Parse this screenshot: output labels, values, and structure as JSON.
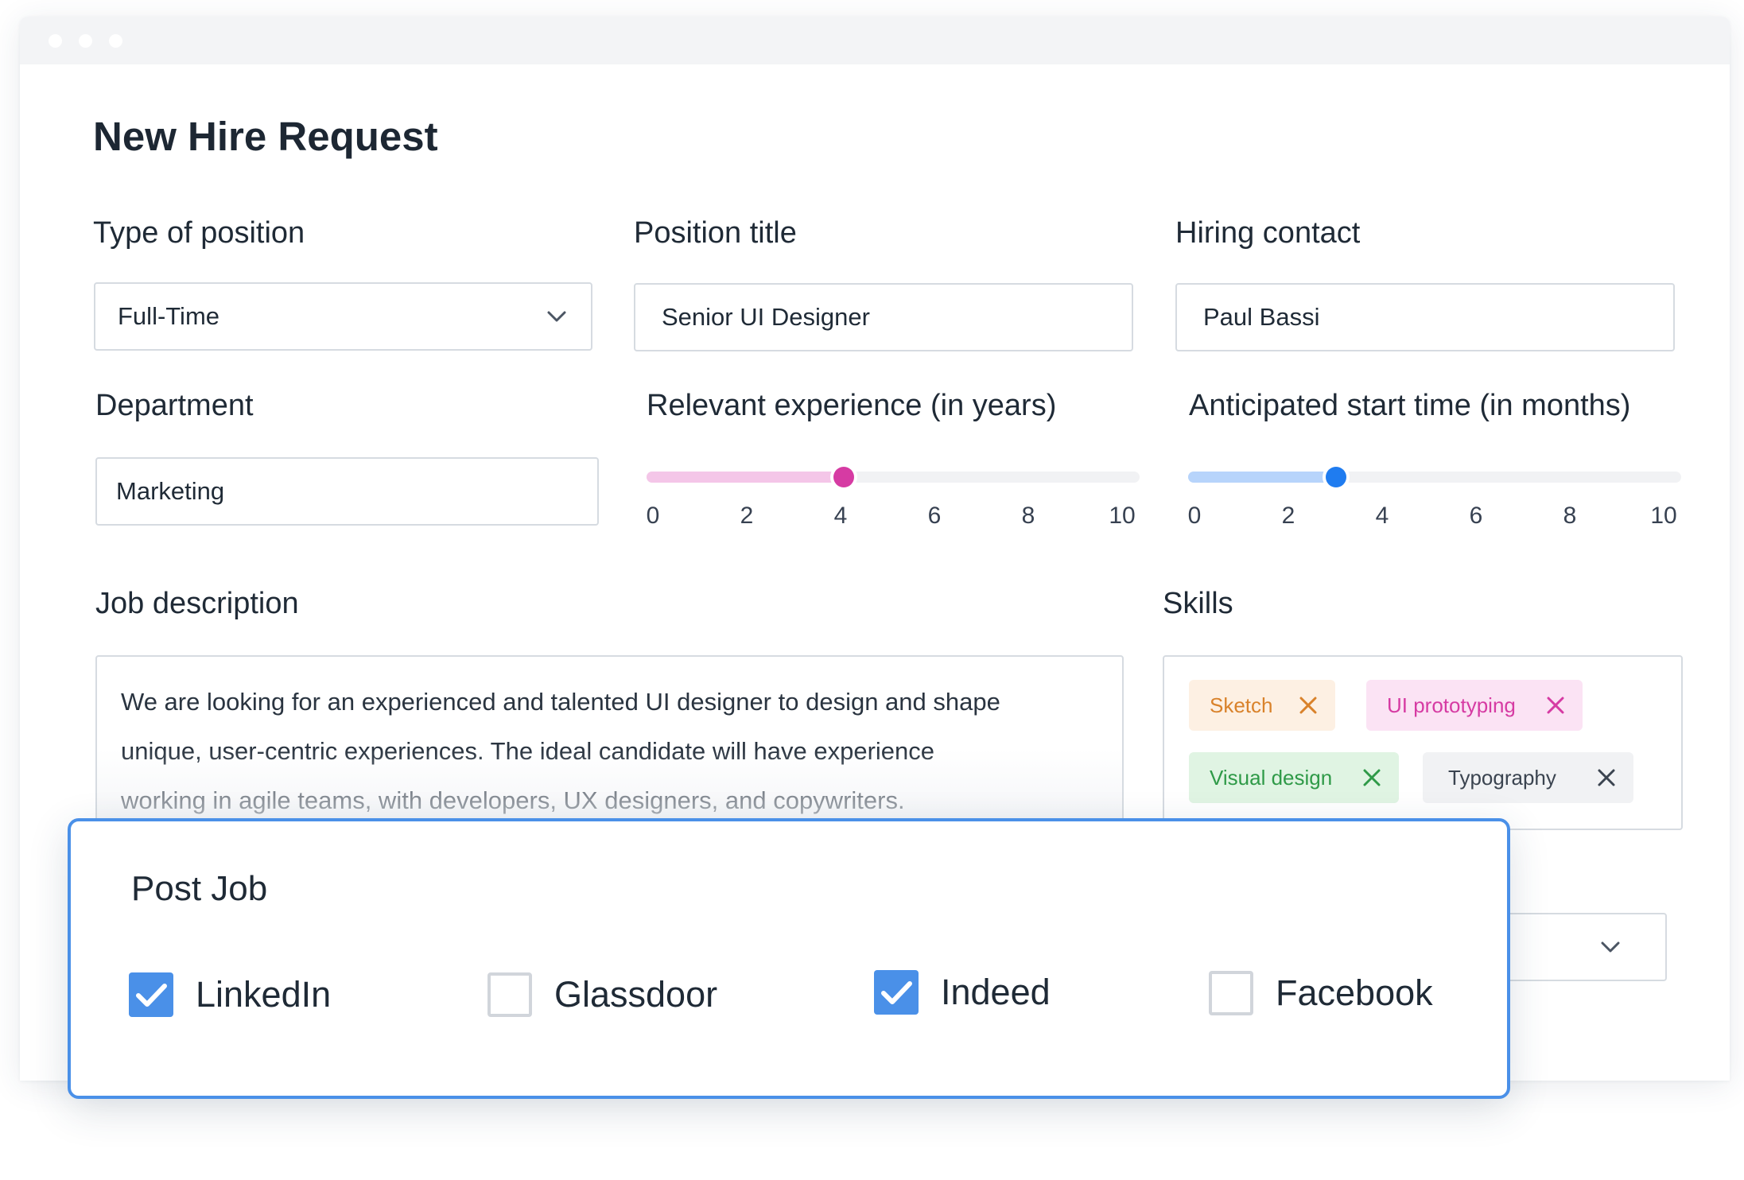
{
  "page": {
    "title": "New Hire Request"
  },
  "position_type": {
    "label": "Type of position",
    "value": "Full-Time",
    "icon": "chevron-down-icon"
  },
  "position_title": {
    "label": "Position title",
    "value": "Senior UI Designer"
  },
  "hiring_contact": {
    "label": "Hiring contact",
    "value": "Paul Bassi"
  },
  "department": {
    "label": "Department",
    "value": "Marketing"
  },
  "experience": {
    "label": "Relevant experience (in years)",
    "value": 4,
    "min": 0,
    "max": 10,
    "ticks": [
      "0",
      "2",
      "4",
      "6",
      "8",
      "10"
    ],
    "fill_color": "#f4c6e8",
    "thumb_color": "#d63ba3"
  },
  "start_time": {
    "label": "Anticipated start time (in months)",
    "value": 3,
    "min": 0,
    "max": 10,
    "ticks": [
      "0",
      "2",
      "4",
      "6",
      "8",
      "10"
    ],
    "fill_color": "#b7d4fb",
    "thumb_color": "#1f7cf0"
  },
  "job_description": {
    "label": "Job description",
    "lines": [
      "We are looking for an experienced and talented UI designer to design and shape",
      "unique, user-centric experiences. The ideal candidate will have experience",
      "working in agile teams, with developers, UX designers, and copywriters."
    ]
  },
  "skills": {
    "label": "Skills",
    "tags": [
      {
        "label": "Sketch",
        "bg": "#fdf0e3",
        "fg": "#d9822b"
      },
      {
        "label": "UI prototyping",
        "bg": "#fbe3f4",
        "fg": "#d63ba3"
      },
      {
        "label": "Visual design",
        "bg": "#e0f4e3",
        "fg": "#2f9a48"
      },
      {
        "label": "Typography",
        "bg": "#f1f2f4",
        "fg": "#3b4450"
      }
    ]
  },
  "post_job": {
    "title": "Post Job",
    "accent": "#4a90e8",
    "options": [
      {
        "label": "LinkedIn",
        "checked": true
      },
      {
        "label": "Glassdoor",
        "checked": false
      },
      {
        "label": "Indeed",
        "checked": true
      },
      {
        "label": "Facebook",
        "checked": false
      }
    ]
  }
}
